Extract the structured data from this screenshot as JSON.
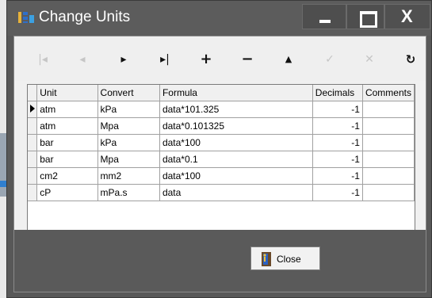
{
  "window": {
    "title": "Change Units",
    "icon": "app-logo-icon",
    "controls": {
      "minimize": "minimize-icon",
      "maximize": "maximize-icon",
      "close": "X"
    }
  },
  "toolbar": {
    "buttons": [
      {
        "name": "first-record",
        "glyph": "|◂",
        "enabled": false
      },
      {
        "name": "prior-record",
        "glyph": "◂",
        "enabled": false
      },
      {
        "name": "next-record",
        "glyph": "▸",
        "enabled": true
      },
      {
        "name": "last-record",
        "glyph": "▸|",
        "enabled": true
      },
      {
        "name": "insert-record",
        "glyph": "+",
        "enabled": true
      },
      {
        "name": "delete-record",
        "glyph": "−",
        "enabled": true
      },
      {
        "name": "edit-record",
        "glyph": "▲",
        "enabled": true
      },
      {
        "name": "post-edit",
        "glyph": "✓",
        "enabled": false
      },
      {
        "name": "cancel-edit",
        "glyph": "✕",
        "enabled": false
      },
      {
        "name": "refresh-data",
        "glyph": "↻",
        "enabled": true
      }
    ]
  },
  "grid": {
    "columns": [
      "Unit",
      "Convert",
      "Formula",
      "Decimals",
      "Comments"
    ],
    "rows": [
      [
        "atm",
        "kPa",
        "data*101.325",
        "-1",
        ""
      ],
      [
        "atm",
        "Mpa",
        "data*0.101325",
        "-1",
        ""
      ],
      [
        "bar",
        "kPa",
        "data*100",
        "-1",
        ""
      ],
      [
        "bar",
        "Mpa",
        "data*0.1",
        "-1",
        ""
      ],
      [
        "cm2",
        "mm2",
        "data*100",
        "-1",
        ""
      ],
      [
        "cP",
        "mPa.s",
        "data",
        "-1",
        ""
      ]
    ],
    "current_row": 0
  },
  "footer": {
    "close_label": "Close"
  },
  "colors": {
    "title_bg": "#5c5c5c",
    "footer_bg": "#5a5a5a",
    "client_bg": "#f0f0f0"
  }
}
